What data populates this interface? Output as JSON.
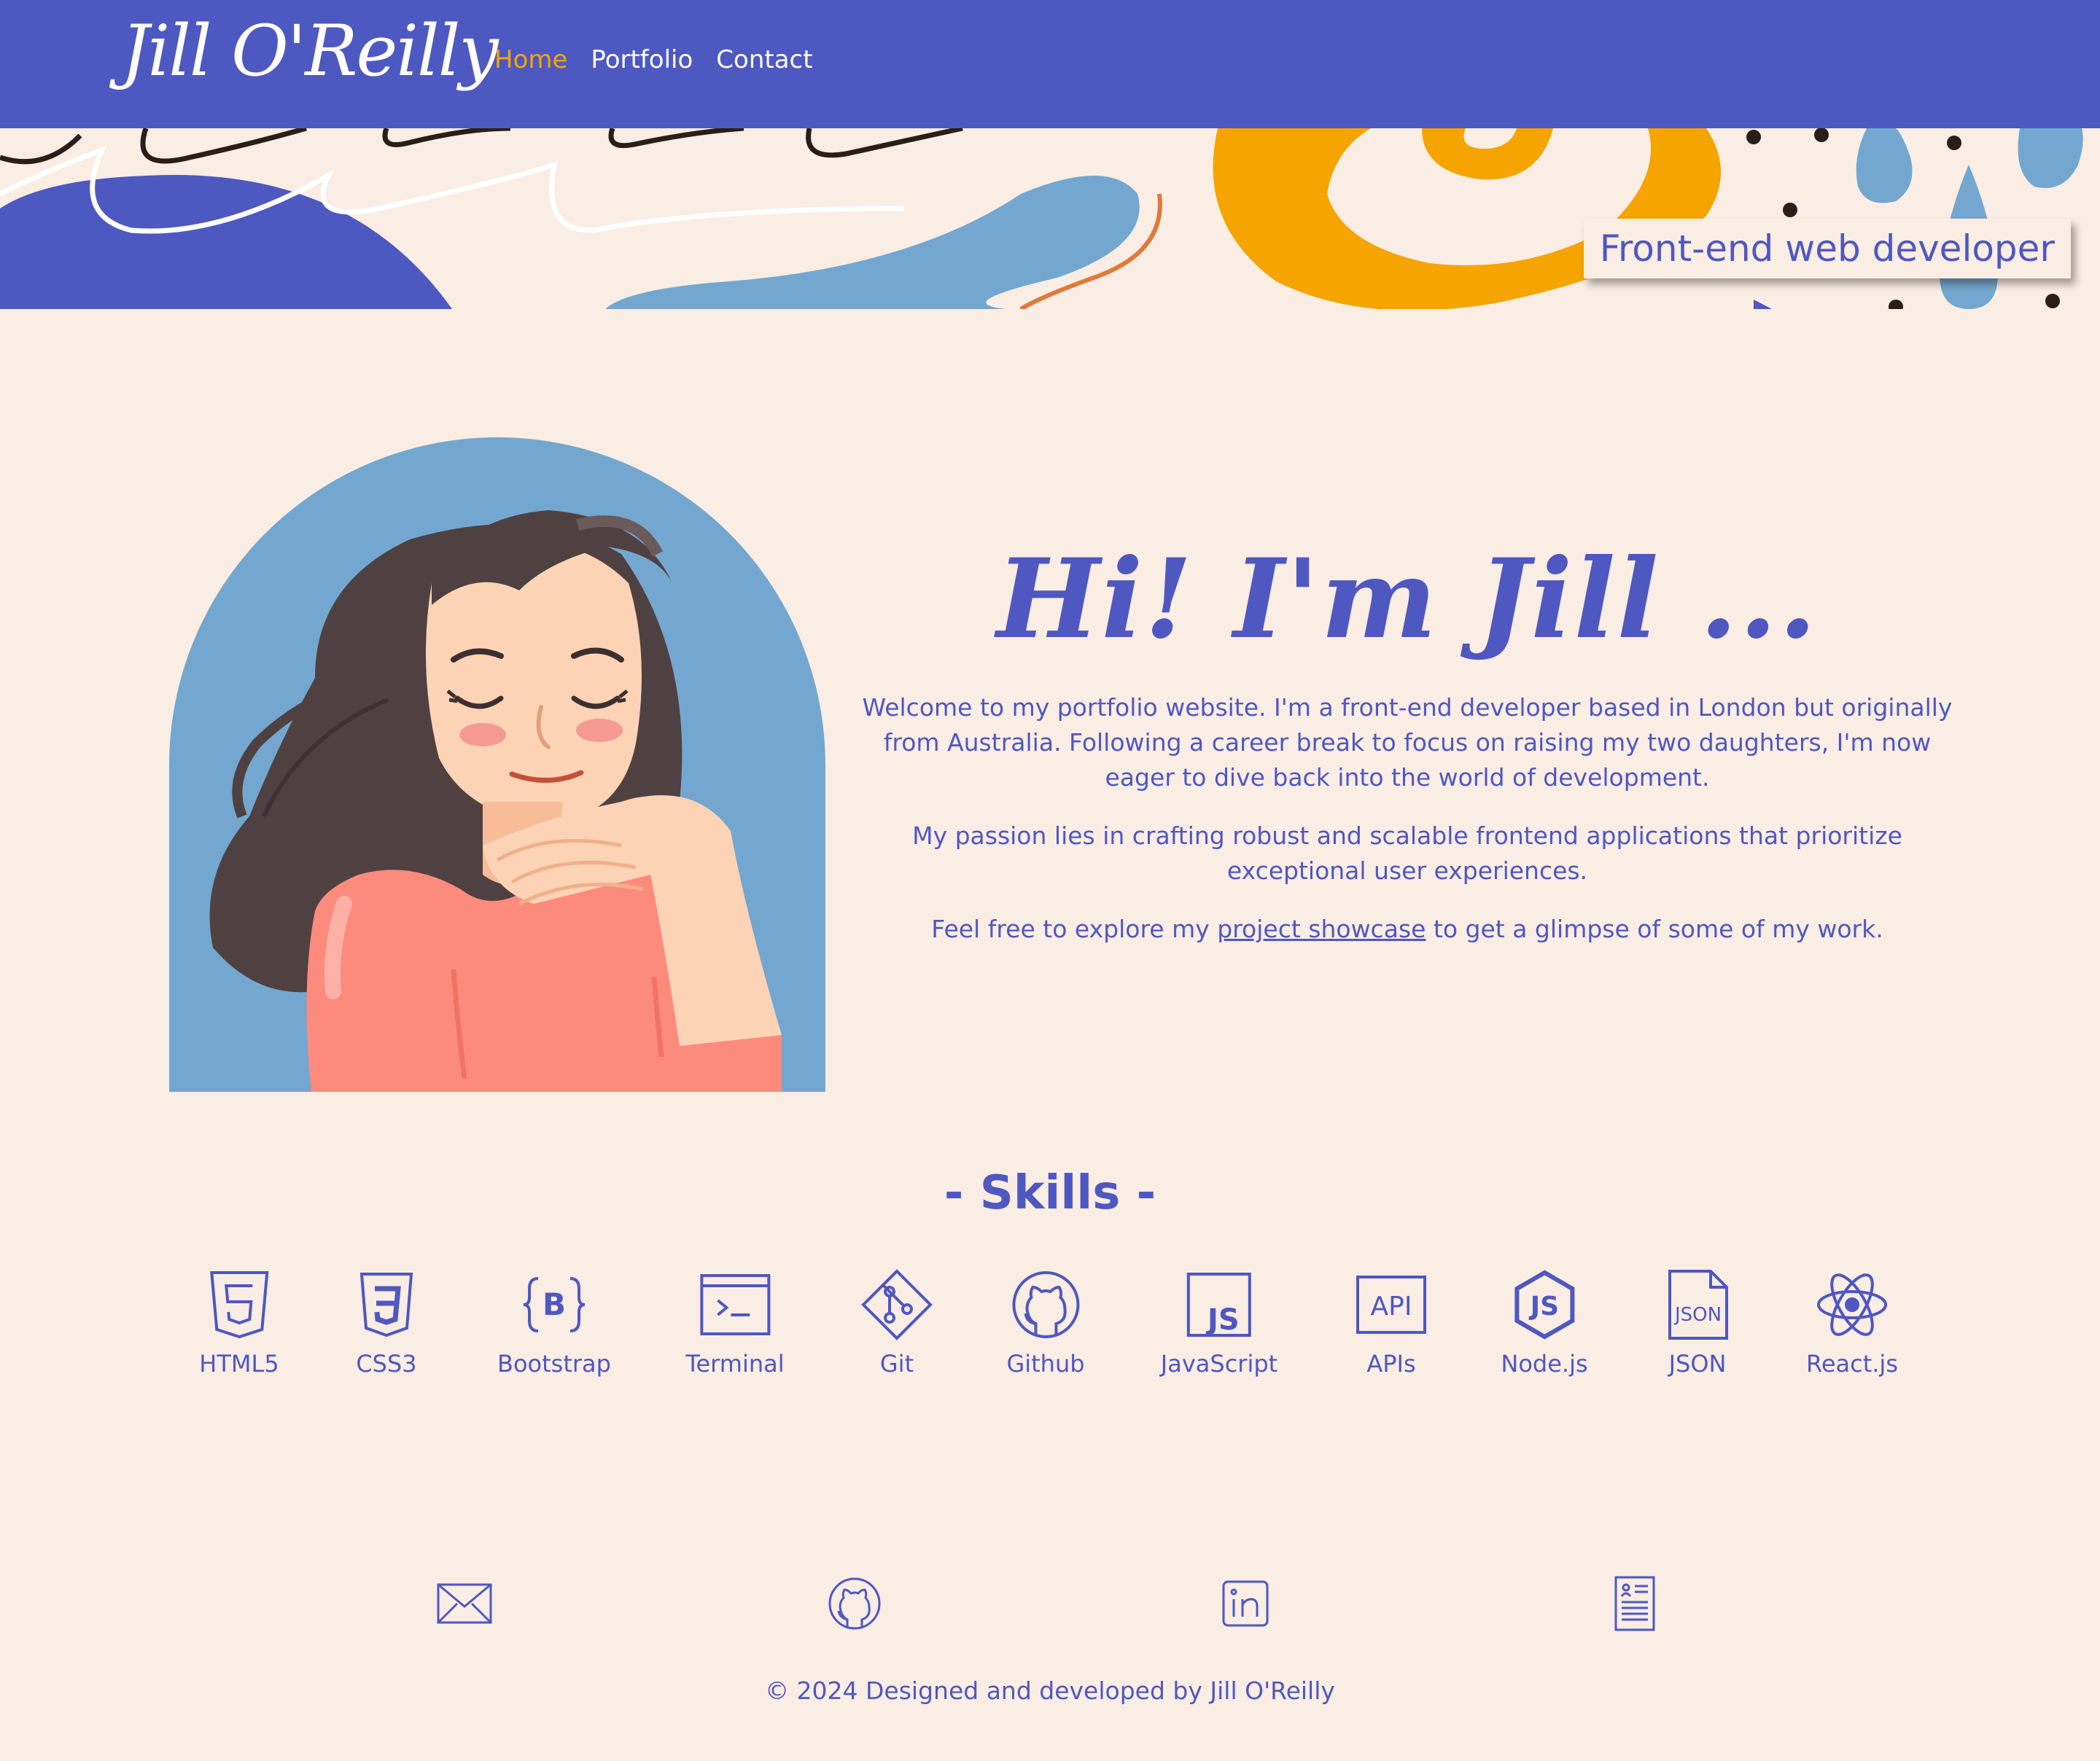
{
  "brand": {
    "name": "Jill O'Reilly"
  },
  "nav": {
    "items": [
      {
        "label": "Home",
        "active": true
      },
      {
        "label": "Portfolio",
        "active": false
      },
      {
        "label": "Contact",
        "active": false
      }
    ]
  },
  "banner": {
    "tagline": "Front-end web developer"
  },
  "intro": {
    "greeting": "Hi! I'm Jill ...",
    "paragraph1": "Welcome to my portfolio website. I'm a front-end developer based in London but originally from Australia. Following a career break to focus on raising my two daughters, I'm now eager to dive back into the world of development.",
    "paragraph2": "My passion lies in crafting robust and scalable frontend applications that prioritize exceptional user experiences.",
    "paragraph3_before": "Feel free to explore my ",
    "paragraph3_link": "project showcase",
    "paragraph3_after": " to get a glimpse of some of my work."
  },
  "skills": {
    "title": "- Skills -",
    "items": [
      {
        "label": "HTML5",
        "icon": "html5-icon"
      },
      {
        "label": "CSS3",
        "icon": "css3-icon"
      },
      {
        "label": "Bootstrap",
        "icon": "bootstrap-icon"
      },
      {
        "label": "Terminal",
        "icon": "terminal-icon"
      },
      {
        "label": "Git",
        "icon": "git-icon"
      },
      {
        "label": "Github",
        "icon": "github-icon"
      },
      {
        "label": "JavaScript",
        "icon": "javascript-icon"
      },
      {
        "label": "APIs",
        "icon": "api-icon"
      },
      {
        "label": "Node.js",
        "icon": "nodejs-icon"
      },
      {
        "label": "JSON",
        "icon": "json-icon"
      },
      {
        "label": "React.js",
        "icon": "react-icon"
      }
    ]
  },
  "footer": {
    "social_icons": [
      "email-icon",
      "github-icon",
      "linkedin-icon",
      "resume-icon"
    ],
    "copyright": "© 2024 Designed and developed by Jill O'Reilly"
  },
  "colors": {
    "primary": "#4e58c1",
    "background": "#f9ede4",
    "accent": "#f5a400",
    "sky_blue": "#74a7cf",
    "shirt_coral": "#fd8b7d"
  }
}
